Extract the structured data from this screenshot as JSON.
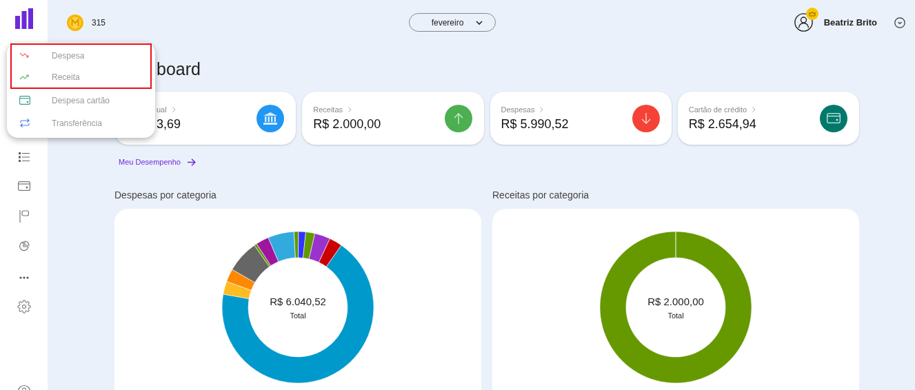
{
  "topbar": {
    "coins": "315",
    "month": {
      "value": "fevereiro"
    },
    "user": {
      "name": "Beatriz Brito",
      "premium": true
    }
  },
  "menu": {
    "items": [
      {
        "label": "Despesa",
        "kind": "down",
        "highlighted": true
      },
      {
        "label": "Receita",
        "kind": "up",
        "highlighted": true
      },
      {
        "label": "Despesa cartão",
        "kind": "card",
        "highlighted": false
      },
      {
        "label": "Transferência",
        "kind": "transfer",
        "highlighted": false
      }
    ]
  },
  "heading": "board",
  "summary_cards": [
    {
      "label": "ual",
      "value": "3,69",
      "kind": "bank",
      "color": "#2196f3"
    },
    {
      "label": "Receitas",
      "value": "R$ 2.000,00",
      "kind": "up",
      "color": "#4caf50"
    },
    {
      "label": "Despesas",
      "value": "R$ 5.990,52",
      "kind": "down",
      "color": "#f44336"
    },
    {
      "label": "Cartão de crédito",
      "value": "R$ 2.654,94",
      "kind": "card",
      "color": "#00796b"
    }
  ],
  "performance_link": "Meu Desempenho",
  "charts": [
    {
      "title": "Despesas por categoria",
      "total": "R$ 6.040,52",
      "total_label": "Total"
    },
    {
      "title": "Receitas por categoria",
      "total": "R$ 2.000,00",
      "total_label": "Total"
    }
  ]
}
